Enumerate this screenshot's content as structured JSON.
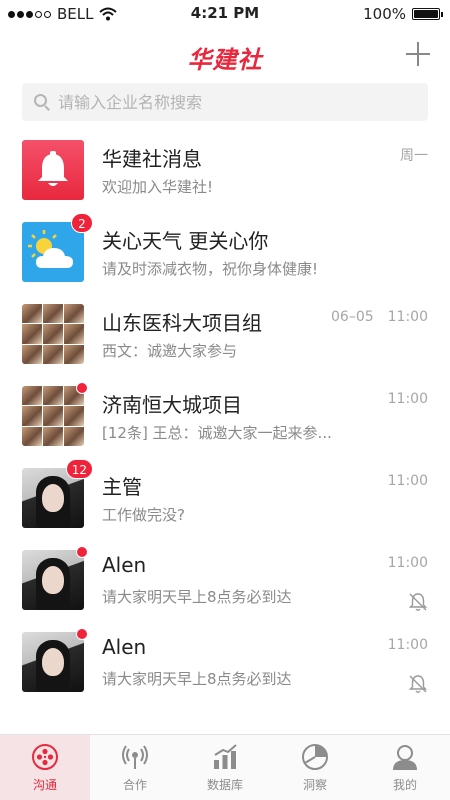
{
  "status_bar": {
    "carrier": "BELL",
    "time": "4:21 PM",
    "battery": "100%",
    "battery_level": 1.0
  },
  "header": {
    "title": "华建社",
    "add_icon": "plus-icon"
  },
  "search": {
    "placeholder": "请输入企业名称搜索",
    "icon": "search-icon"
  },
  "chats": [
    {
      "name": "华建社消息",
      "preview": "欢迎加入华建社!",
      "time": "周一",
      "date": "",
      "avatar": "bell-icon",
      "badge": "",
      "dot": false,
      "muted": false
    },
    {
      "name": "关心天气 更关心你",
      "preview": "请及时添减衣物，祝你身体健康!",
      "time": "",
      "date": "",
      "avatar": "weather-icon",
      "badge": "2",
      "dot": false,
      "muted": false
    },
    {
      "name": "山东医科大项目组",
      "preview": "西文：诚邀大家参与",
      "time": "11:00",
      "date": "06–05",
      "avatar": "group-avatar",
      "badge": "",
      "dot": false,
      "muted": false
    },
    {
      "name": "济南恒大城项目",
      "preview": "[12条] 王总：诚邀大家一起来参...",
      "time": "11:00",
      "date": "",
      "avatar": "group-avatar",
      "badge": "",
      "dot": true,
      "muted": false
    },
    {
      "name": "主管",
      "preview": "工作做完没?",
      "time": "11:00",
      "date": "",
      "avatar": "person-avatar",
      "badge": "12",
      "dot": false,
      "muted": false
    },
    {
      "name": "Alen",
      "preview": "请大家明天早上8点务必到达",
      "time": "11:00",
      "date": "",
      "avatar": "person-avatar",
      "badge": "",
      "dot": true,
      "muted": true
    },
    {
      "name": "Alen",
      "preview": "请大家明天早上8点务必到达",
      "time": "11:00",
      "date": "",
      "avatar": "person-avatar",
      "badge": "",
      "dot": true,
      "muted": true
    }
  ],
  "tabs": [
    {
      "label": "沟通",
      "icon": "chat-film-icon",
      "active": true
    },
    {
      "label": "合作",
      "icon": "broadcast-icon",
      "active": false
    },
    {
      "label": "数据库",
      "icon": "bar-chart-icon",
      "active": false
    },
    {
      "label": "洞察",
      "icon": "pie-chart-icon",
      "active": false
    },
    {
      "label": "我的",
      "icon": "profile-icon",
      "active": false
    }
  ],
  "colors": {
    "brand": "#e8283d",
    "badge": "#f0233b",
    "weather_bg": "#2fa6ea"
  }
}
